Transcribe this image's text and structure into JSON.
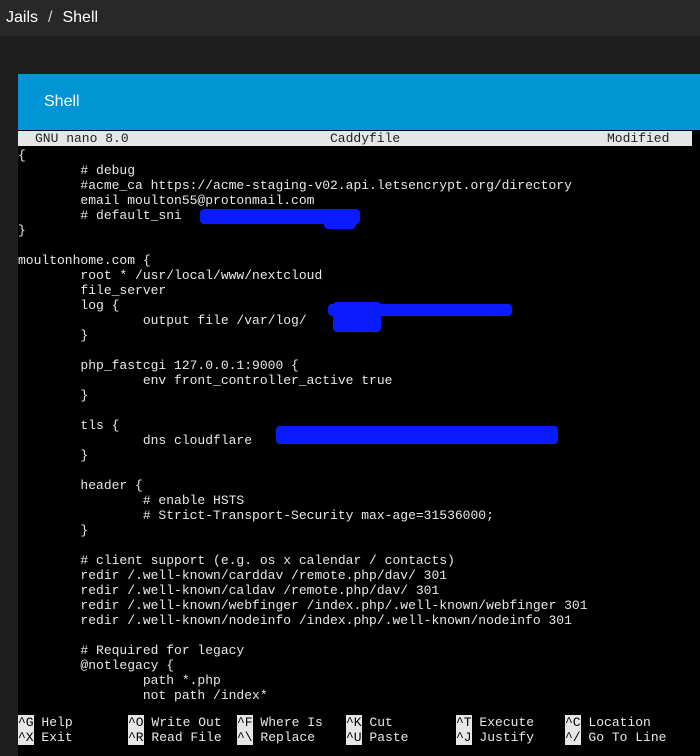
{
  "breadcrumb": {
    "items": [
      "Jails",
      "Shell"
    ],
    "separator": "/"
  },
  "panel": {
    "title": "Shell"
  },
  "nano": {
    "version": "GNU nano 8.0",
    "filename": "Caddyfile",
    "status": "Modified"
  },
  "file_lines": [
    "{",
    "        # debug",
    "        #acme_ca https://acme-staging-v02.api.letsencrypt.org/directory",
    "        email moulton55@protonmail.com",
    "        # default_sni",
    "}",
    "",
    "moultonhome.com {",
    "        root * /usr/local/www/nextcloud",
    "        file_server",
    "        log {",
    "                output file /var/log/",
    "        }",
    "",
    "        php_fastcgi 127.0.0.1:9000 {",
    "                env front_controller_active true",
    "        }",
    "",
    "        tls {",
    "                dns cloudflare",
    "        }",
    "",
    "        header {",
    "                # enable HSTS",
    "                # Strict-Transport-Security max-age=31536000;",
    "        }",
    "",
    "        # client support (e.g. os x calendar / contacts)",
    "        redir /.well-known/carddav /remote.php/dav/ 301",
    "        redir /.well-known/caldav /remote.php/dav/ 301",
    "        redir /.well-known/webfinger /index.php/.well-known/webfinger 301",
    "        redir /.well-known/nodeinfo /index.php/.well-known/nodeinfo 301",
    "",
    "        # Required for legacy",
    "        @notlegacy {",
    "                path *.php",
    "                not path /index*"
  ],
  "shortcuts": [
    [
      {
        "key": "^G",
        "label": "Help"
      },
      {
        "key": "^O",
        "label": "Write Out"
      },
      {
        "key": "^F",
        "label": "Where Is"
      },
      {
        "key": "^K",
        "label": "Cut"
      },
      {
        "key": "^T",
        "label": "Execute"
      },
      {
        "key": "^C",
        "label": "Location"
      }
    ],
    [
      {
        "key": "^X",
        "label": "Exit"
      },
      {
        "key": "^R",
        "label": "Read File"
      },
      {
        "key": "^\\",
        "label": "Replace"
      },
      {
        "key": "^U",
        "label": "Paste"
      },
      {
        "key": "^J",
        "label": "Justify"
      },
      {
        "key": "^/",
        "label": "Go To Line"
      }
    ]
  ],
  "colors": {
    "topbar": "#282828",
    "panel_header": "#0095d5",
    "redaction": "#0a1cff",
    "terminal_bg": "#000000"
  }
}
